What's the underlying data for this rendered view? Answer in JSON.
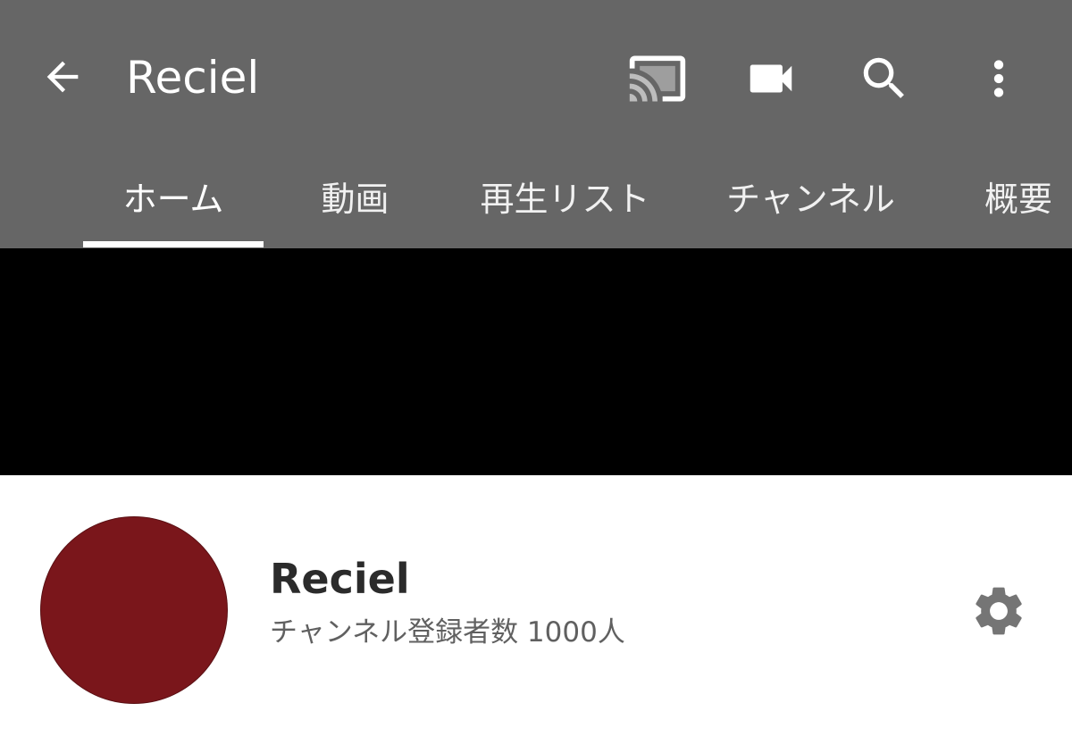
{
  "appbar": {
    "title": "Reciel",
    "background_color": "#666666",
    "icons": {
      "back": "arrow-back-icon",
      "cast": "cast-icon",
      "video": "videocam-icon",
      "search": "search-icon",
      "more": "more-vert-icon"
    }
  },
  "tabs": [
    {
      "label": "ホーム",
      "selected": true
    },
    {
      "label": "動画",
      "selected": false
    },
    {
      "label": "再生リスト",
      "selected": false
    },
    {
      "label": "チャンネル",
      "selected": false
    },
    {
      "label": "概要",
      "selected": false
    }
  ],
  "banner": {
    "color": "#000000"
  },
  "channel": {
    "name": "Reciel",
    "subscribers": "チャンネル登録者数 1000人",
    "avatar_color": "#7a161b",
    "settings_icon": "gear-icon"
  }
}
